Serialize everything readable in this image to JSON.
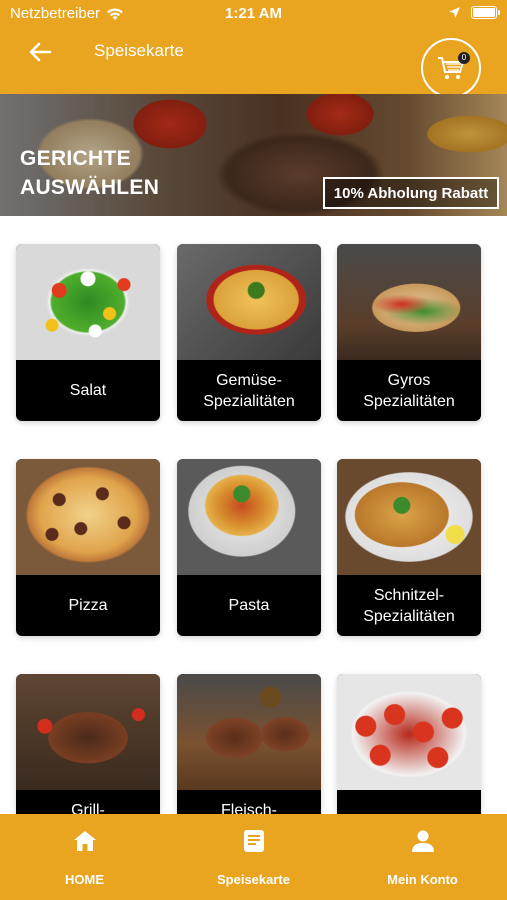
{
  "status_bar": {
    "carrier": "Netzbetreiber",
    "time": "1:21 AM"
  },
  "header": {
    "title": "Speisekarte",
    "cart_count": "0"
  },
  "banner": {
    "title_line1": "GERICHTE",
    "title_line2": "AUSWÄHLEN",
    "badge": "10% Abholung Rabatt"
  },
  "categories": [
    {
      "label": "Salat"
    },
    {
      "label": "Gemüse-\nSpezialitäten"
    },
    {
      "label": "Gyros\nSpezialitäten"
    },
    {
      "label": "Pizza"
    },
    {
      "label": "Pasta"
    },
    {
      "label": "Schnitzel-\nSpezialitäten"
    },
    {
      "label": "Grill-"
    },
    {
      "label": "Fleisch-"
    },
    {
      "label": ""
    }
  ],
  "bottom_nav": [
    {
      "label": "HOME",
      "icon": "home-icon"
    },
    {
      "label": "Speisekarte",
      "icon": "menu-list-icon"
    },
    {
      "label": "Mein Konto",
      "icon": "user-icon"
    }
  ],
  "colors": {
    "accent": "#E9A520",
    "tile_label_bg": "#000000"
  }
}
